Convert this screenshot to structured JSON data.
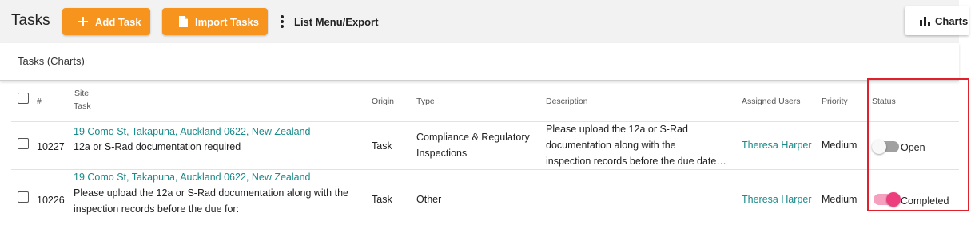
{
  "header": {
    "title": "Tasks",
    "add_task_label": "Add Task",
    "import_tasks_label": "Import Tasks",
    "list_menu_label": "List Menu/Export",
    "charts_label": "Charts"
  },
  "subheader": {
    "title": "Tasks (Charts)"
  },
  "table": {
    "columns": {
      "number": "#",
      "site": "Site",
      "task": "Task",
      "origin": "Origin",
      "type": "Type",
      "description": "Description",
      "assigned_users": "Assigned Users",
      "priority": "Priority",
      "status": "Status"
    },
    "rows": [
      {
        "id": "10227",
        "site": "19 Como St, Takapuna, Auckland 0622, New Zealand",
        "task_line1": "12a or S-Rad documentation required",
        "task_line2": "",
        "origin": "Task",
        "type_line1": "Compliance & Regulatory",
        "type_line2": "Inspections",
        "desc_line1": "Please upload the 12a or S-Rad",
        "desc_line2": "documentation along with the",
        "desc_line3": "inspection records before the due date…",
        "assigned": "Theresa Harper",
        "priority": "Medium",
        "status": "Open",
        "status_on": false
      },
      {
        "id": "10226",
        "site": "19 Como St, Takapuna, Auckland 0622, New Zealand",
        "task_line1": "Please upload the 12a or S-Rad documentation along with the",
        "task_line2": "inspection records before the due for:",
        "origin": "Task",
        "type_line1": "Other",
        "assigned": "Theresa Harper",
        "priority": "Medium",
        "status": "Completed",
        "status_on": true
      }
    ]
  },
  "colors": {
    "accent": "#f7941d",
    "link": "#1a8a8a",
    "toggle_on": "#ee3d7c",
    "highlight": "#e0202a"
  },
  "icons": [
    "plus-icon",
    "document-icon",
    "kebab-icon",
    "bar-chart-icon",
    "checkbox-icon"
  ]
}
